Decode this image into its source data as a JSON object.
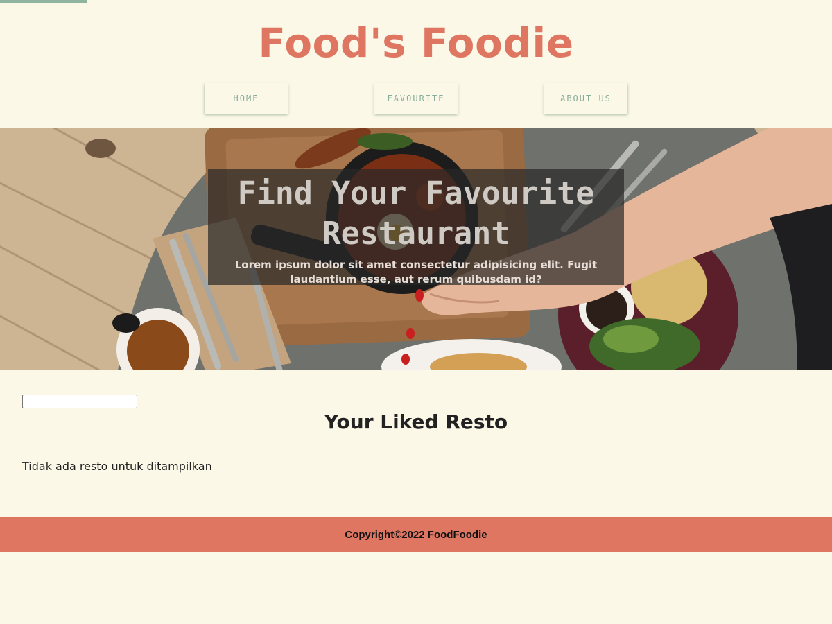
{
  "header": {
    "brand": "Food's Foodie",
    "nav": [
      {
        "label": "HOME"
      },
      {
        "label": "FAVOURITE"
      },
      {
        "label": "ABOUT US"
      }
    ]
  },
  "hero": {
    "title": "Find Your Favourite Restaurant",
    "description": "Lorem ipsum dolor sit amet consectetur adipisicing elit. Fugit laudantium esse, aut rerum quibusdam id?"
  },
  "main": {
    "search_value": "",
    "title": "Your Liked Resto",
    "empty_message": "Tidak ada resto untuk ditampilkan"
  },
  "footer": {
    "copyright": "Copyright©2022 FoodFoodie"
  },
  "colors": {
    "background": "#fbf8e7",
    "brand": "#de7662",
    "nav_text": "#86ad99",
    "accent_bar": "#8fb5a0",
    "footer": "#de7662"
  }
}
